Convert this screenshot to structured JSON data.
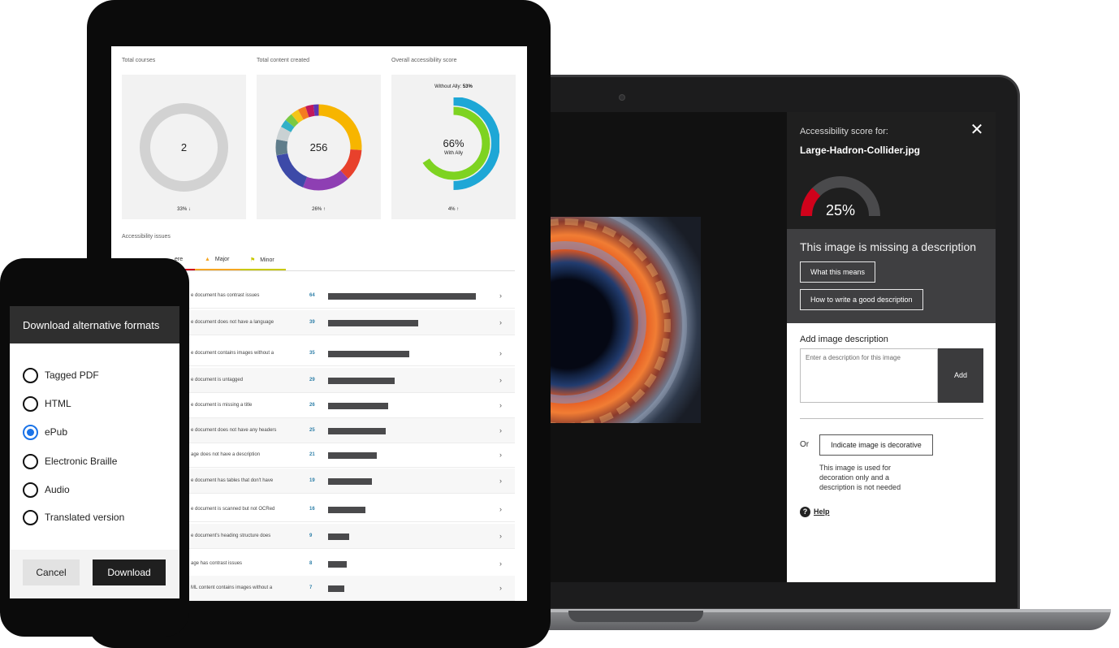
{
  "laptop": {
    "panel": {
      "subtitle": "Accessibility score for:",
      "filename": "Large-Hadron-Collider.jpg",
      "score": 25,
      "score_text": "25%",
      "missing_text": "This image is missing a description",
      "what_means_label": "What this means",
      "how_write_label": "How to write a good description",
      "add_description_label": "Add image description",
      "description_placeholder": "Enter a description for this image",
      "add_label": "Add",
      "or_label": "Or",
      "decorative_label": "Indicate image is decorative",
      "decorative_note": "This image is used for decoration only and a description is not needed",
      "help_label": "Help",
      "colors": {
        "score_low": "#d0021b",
        "dark": "#1f1f1f",
        "mid": "#3f3f41"
      }
    }
  },
  "dashboard": {
    "total_courses": {
      "title": "Total courses",
      "value": "2",
      "footer": "33% ↓"
    },
    "total_content": {
      "title": "Total content created",
      "value": "256",
      "footer": "26% ↑",
      "segments": [
        {
          "value": 26,
          "color": "#f7b500"
        },
        {
          "value": 12,
          "color": "#e8412c"
        },
        {
          "value": 18,
          "color": "#8e3fb3"
        },
        {
          "value": 16,
          "color": "#3d4aa8"
        },
        {
          "value": 6,
          "color": "#607d8b"
        },
        {
          "value": 5,
          "color": "#c9d1d3"
        },
        {
          "value": 3,
          "color": "#31b0c8"
        },
        {
          "value": 3,
          "color": "#7ac943"
        },
        {
          "value": 3,
          "color": "#f5c518"
        },
        {
          "value": 3,
          "color": "#f47b20"
        },
        {
          "value": 3,
          "color": "#c2185b"
        },
        {
          "value": 2,
          "color": "#5e35b1"
        }
      ]
    },
    "overall_score": {
      "title": "Overall accessibility score",
      "without_label": "Without Ally:",
      "without_value": "53%",
      "with_value": "66%",
      "with_label": "With Ally",
      "footer": "4% ↑",
      "colors": {
        "outer": "#1ea7d6",
        "inner": "#7ed321"
      }
    },
    "issues_title": "Accessibility issues",
    "tabs": [
      {
        "label": "ere",
        "color": "#d0021b"
      },
      {
        "label": "Major",
        "icon": "warning-icon",
        "color": "#f5a623"
      },
      {
        "label": "Minor",
        "icon": "flag-icon",
        "color": "#c8c800"
      }
    ],
    "issues": [
      {
        "text": "e document has contrast issues",
        "count": 64
      },
      {
        "text": "e document does not have a language",
        "count": 39
      },
      {
        "text": "e document contains images without a",
        "count": 35
      },
      {
        "text": "e document is untagged",
        "count": 29
      },
      {
        "text": "e document is missing a title",
        "count": 26
      },
      {
        "text": "e document does not have any headers",
        "count": 25
      },
      {
        "text": "age does not have a description",
        "count": 21
      },
      {
        "text": "e document has tables that don't have",
        "count": 19
      },
      {
        "text": "e document is scanned but not OCRed",
        "count": 16
      },
      {
        "text": "e document's heading structure does",
        "count": 9
      },
      {
        "text": "age has contrast issues",
        "count": 8
      },
      {
        "text": "ML content contains images without a",
        "count": 7
      }
    ]
  },
  "phone": {
    "dialog_title": "Download alternative formats",
    "options": [
      {
        "label": "Tagged PDF",
        "checked": false
      },
      {
        "label": "HTML",
        "checked": false
      },
      {
        "label": "ePub",
        "checked": true
      },
      {
        "label": "Electronic Braille",
        "checked": false
      },
      {
        "label": "Audio",
        "checked": false
      },
      {
        "label": "Translated version",
        "checked": false
      }
    ],
    "cancel_label": "Cancel",
    "download_label": "Download"
  }
}
